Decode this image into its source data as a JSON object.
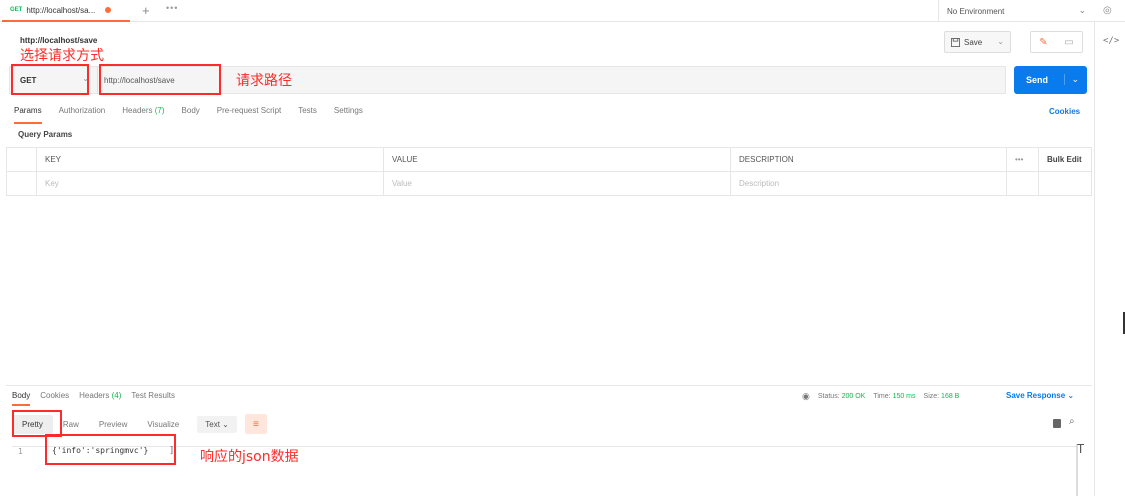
{
  "tab": {
    "method": "GET",
    "title": "http://localhost/sa...",
    "new_tab": "+",
    "more": "•••"
  },
  "environment": {
    "label": "No Environment"
  },
  "request": {
    "name": "http://localhost/save",
    "save_label": "Save",
    "method": "GET",
    "url": "http://localhost/save",
    "send_label": "Send"
  },
  "annotations": {
    "method": "选择请求方式",
    "url": "请求路径",
    "response": "响应的json数据"
  },
  "request_tabs": [
    {
      "label": "Params",
      "count": ""
    },
    {
      "label": "Authorization",
      "count": ""
    },
    {
      "label": "Headers",
      "count": "(7)"
    },
    {
      "label": "Body",
      "count": ""
    },
    {
      "label": "Pre-request Script",
      "count": ""
    },
    {
      "label": "Tests",
      "count": ""
    },
    {
      "label": "Settings",
      "count": ""
    }
  ],
  "cookies_label": "Cookies",
  "query_params": {
    "title": "Query Params",
    "headers": {
      "key": "KEY",
      "value": "VALUE",
      "description": "DESCRIPTION",
      "more": "•••",
      "bulk": "Bulk Edit"
    },
    "placeholders": {
      "key": "Key",
      "value": "Value",
      "description": "Description"
    }
  },
  "response_tabs": [
    {
      "label": "Body",
      "count": ""
    },
    {
      "label": "Cookies",
      "count": ""
    },
    {
      "label": "Headers",
      "count": "(4)"
    },
    {
      "label": "Test Results",
      "count": ""
    }
  ],
  "response_meta": {
    "status_label": "Status:",
    "status": "200 OK",
    "time_label": "Time:",
    "time": "150 ms",
    "size_label": "Size:",
    "size": "168 B",
    "save_response": "Save Response"
  },
  "format_tabs": [
    "Pretty",
    "Raw",
    "Preview",
    "Visualize"
  ],
  "format_select": "Text",
  "response_body": {
    "line": "1",
    "code": "{'info':'springmvc'}"
  },
  "colors": {
    "accent": "#ff6c37",
    "primary": "#097bed",
    "success": "#0cbb52",
    "annotation": "#ff2a2a"
  },
  "icons": [
    "plus-icon",
    "more-icon",
    "chevron-down-icon",
    "eye-icon",
    "save-icon",
    "edit-icon",
    "comment-icon",
    "code-icon",
    "globe-icon",
    "copy-icon",
    "search-icon",
    "wrap-icon"
  ]
}
